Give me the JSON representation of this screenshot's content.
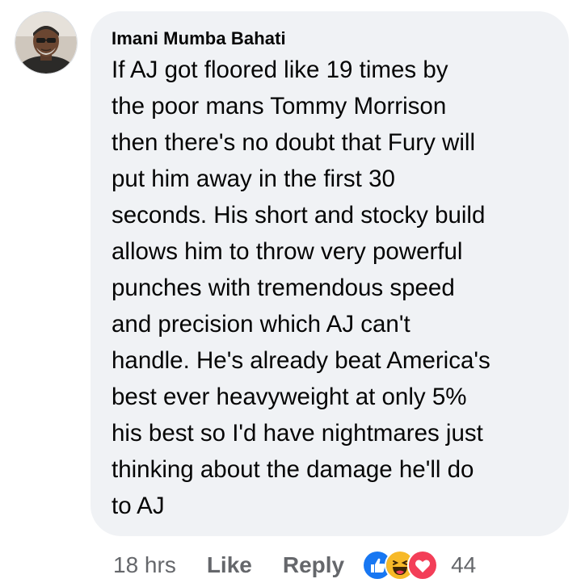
{
  "comment": {
    "author": "Imani Mumba Bahati",
    "text": "If AJ got floored like 19 times by\nthe poor mans Tommy Morrison\nthen there's no doubt that Fury will\nput him away in the first 30\nseconds. His short and stocky build\nallows him to throw very powerful\npunches with tremendous speed\nand precision which AJ can't\nhandle. He's already beat America's\nbest ever heavyweight at only 5%\nhis best so I'd have nightmares just\nthinking about the damage he'll do\nto AJ"
  },
  "actions": {
    "time": "18 hrs",
    "like_label": "Like",
    "reply_label": "Reply",
    "reaction_count": "44",
    "reactions": [
      "like-reaction-icon",
      "haha-reaction-icon",
      "love-reaction-icon"
    ]
  },
  "colors": {
    "bubble": "#f0f2f5",
    "text": "#050505",
    "secondary": "#65676b",
    "like_blue": "#1877f2",
    "haha_yellow": "#f7b928",
    "love_red": "#f33e58"
  }
}
